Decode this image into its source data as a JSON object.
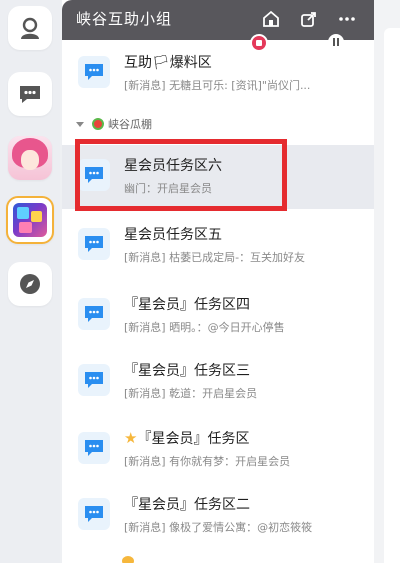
{
  "header": {
    "title": "峡谷互助小组"
  },
  "rows": [
    {
      "title": "互助🏳爆料区",
      "sub_tag": "[新消息]",
      "sub_text": "无糖且可乐: [资讯]\"尚仪门..."
    },
    {
      "title": "星会员任务区六",
      "sub_tag": "",
      "sub_text": "幽门：开启星会员"
    },
    {
      "title": "星会员任务区五",
      "sub_tag": "[新消息]",
      "sub_text": "枯萎已成定局-：互关加好友"
    },
    {
      "title": "『星会员』任务区四",
      "sub_tag": "[新消息]",
      "sub_text": "晒明。：@今日开心停售"
    },
    {
      "title": "『星会员』任务区三",
      "sub_tag": "[新消息]",
      "sub_text": "乾道：开启星会员"
    },
    {
      "title": "『星会员』任务区",
      "sub_tag": "[新消息]",
      "sub_text": "有你就有梦：开启星会员"
    },
    {
      "title": "『星会员』任务区二",
      "sub_tag": "[新消息]",
      "sub_text": "像极了爱情公寓：@初恋筱筱"
    }
  ],
  "group": {
    "label": "峡谷瓜棚"
  },
  "colors": {
    "titlebar": "#58575c",
    "highlight": "#e52b2f",
    "accent_blue": "#2a8ef0",
    "star": "#f6b73c"
  },
  "icons": {
    "rail": [
      "user-icon",
      "chat-icon",
      "avatar-image",
      "game-icon",
      "compass-icon"
    ],
    "titlebar": [
      "home-icon",
      "share-icon",
      "more-icon"
    ],
    "channel": "channel-chat-icon"
  }
}
